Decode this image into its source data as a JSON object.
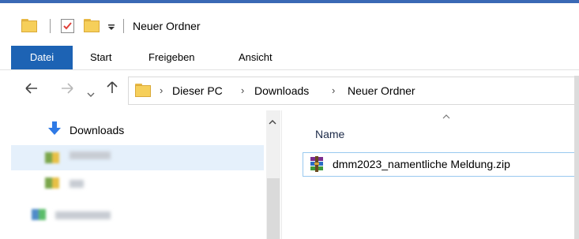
{
  "window": {
    "title": "Neuer Ordner"
  },
  "ribbon": {
    "tabs": [
      "Datei",
      "Start",
      "Freigeben",
      "Ansicht"
    ]
  },
  "address": {
    "crumbs": [
      "Dieser PC",
      "Downloads",
      "Neuer Ordner"
    ]
  },
  "sidebar": {
    "items": [
      {
        "label": "Downloads",
        "icon": "download-arrow-icon"
      }
    ]
  },
  "content": {
    "column_header": "Name",
    "files": [
      {
        "name": "dmm2023_namentliche Meldung.zip",
        "icon": "winrar-archive-icon"
      }
    ]
  },
  "colors": {
    "accent": "#1d63b4",
    "selection": "#e5f0fb",
    "folder": "#f6cf5a"
  }
}
